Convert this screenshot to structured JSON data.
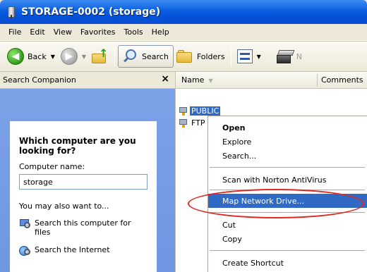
{
  "window": {
    "title": "STORAGE-0002 (storage)"
  },
  "menubar": {
    "items": [
      "File",
      "Edit",
      "View",
      "Favorites",
      "Tools",
      "Help"
    ]
  },
  "toolbar": {
    "back_label": "Back",
    "search_label": "Search",
    "folders_label": "Folders",
    "overflow_text": "N"
  },
  "search_companion": {
    "header": "Search Companion",
    "close_glyph": "×",
    "question": "Which computer are you looking for?",
    "computer_name_label": "Computer name:",
    "computer_name_value": "storage",
    "also_label": "You may also want to...",
    "links": [
      "Search this computer for files",
      "Search the Internet"
    ]
  },
  "file_list": {
    "columns": {
      "name": "Name",
      "comments": "Comments"
    },
    "items": [
      {
        "name": "PUBLIC",
        "selected": true
      },
      {
        "name": "FTP",
        "selected": false
      }
    ]
  },
  "context_menu": {
    "items": [
      {
        "label": "Open",
        "bold": true
      },
      {
        "label": "Explore"
      },
      {
        "label": "Search..."
      },
      {
        "label": "Scan with Norton AntiVirus"
      },
      {
        "label": "Map Network Drive...",
        "highlighted": true
      },
      {
        "label": "Cut"
      },
      {
        "label": "Copy"
      },
      {
        "label": "Create Shortcut"
      }
    ]
  },
  "colors": {
    "titlebar": "#0a5fe0",
    "selection": "#316ac5",
    "pane_background": "#7ba2e7",
    "annotation": "#e0261e"
  }
}
